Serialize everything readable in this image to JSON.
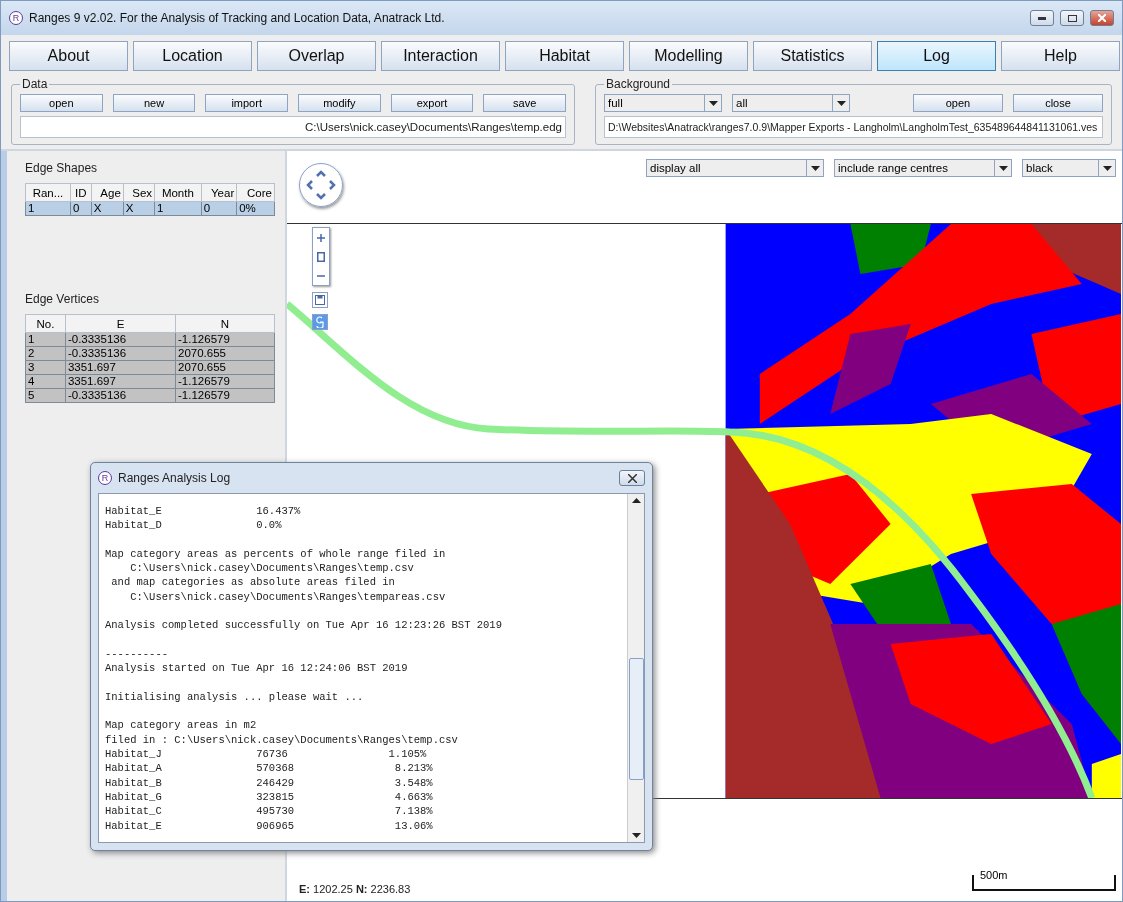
{
  "window": {
    "logo": "R",
    "title": "Ranges 9 v2.02. For the Analysis of Tracking and Location Data, Anatrack Ltd."
  },
  "menu": [
    {
      "label": "About",
      "selected": false
    },
    {
      "label": "Location",
      "selected": false
    },
    {
      "label": "Overlap",
      "selected": false
    },
    {
      "label": "Interaction",
      "selected": false
    },
    {
      "label": "Habitat",
      "selected": false
    },
    {
      "label": "Modelling",
      "selected": false
    },
    {
      "label": "Statistics",
      "selected": false
    },
    {
      "label": "Log",
      "selected": true
    },
    {
      "label": "Help",
      "selected": false
    }
  ],
  "data_panel": {
    "title": "Data",
    "buttons": [
      "open",
      "new",
      "import",
      "modify",
      "export",
      "save"
    ],
    "path": "C:\\Users\\nick.casey\\Documents\\Ranges\\temp.edg"
  },
  "background_panel": {
    "title": "Background",
    "dropdowns": [
      "full",
      "all"
    ],
    "buttons": [
      "open",
      "close"
    ],
    "path": "D:\\Websites\\Anatrack\\ranges7.0.9\\Mapper Exports - Langholm\\LangholmTest_635489644841131061.ves"
  },
  "edge_shapes": {
    "title": "Edge Shapes",
    "columns": [
      "Ran...",
      "ID",
      "Age",
      "Sex",
      "Month",
      "Year",
      "Core"
    ],
    "rows": [
      {
        "cells": [
          "1",
          "0",
          "X",
          "X",
          "1",
          "0",
          "0%"
        ],
        "selected": true
      }
    ]
  },
  "edge_vertices": {
    "title": "Edge Vertices",
    "columns": [
      "No.",
      "E",
      "N"
    ],
    "rows": [
      {
        "cells": [
          "1",
          "-0.3335136",
          "-1.126579"
        ],
        "selected": true
      },
      {
        "cells": [
          "2",
          "-0.3335136",
          "2070.655"
        ],
        "selected": true
      },
      {
        "cells": [
          "3",
          "3351.697",
          "2070.655"
        ],
        "selected": true
      },
      {
        "cells": [
          "4",
          "3351.697",
          "-1.126579"
        ],
        "selected": true
      },
      {
        "cells": [
          "5",
          "-0.3335136",
          "-1.126579"
        ],
        "selected": true
      }
    ]
  },
  "map_options": [
    "display all",
    "include range centres",
    "black"
  ],
  "status": {
    "coordinates": "**E:** 1202.25 **N:** 2236.83",
    "scale": "500m"
  },
  "log_window": {
    "logo": "R",
    "title": "Ranges Analysis Log",
    "paragraphs": [
      [
        "Habitat_E               16.437%",
        "Habitat_D               0.0%"
      ],
      [
        "Map category areas as percents of whole range filed in",
        "    C:\\Users\\nick.casey\\Documents\\Ranges\\temp.csv",
        " and map categories as absolute areas filed in",
        "    C:\\Users\\nick.casey\\Documents\\Ranges\\tempareas.csv"
      ],
      [
        "Analysis completed successfully on Tue Apr 16 12:23:26 BST 2019"
      ],
      [
        "----------",
        "Analysis started on Tue Apr 16 12:24:06 BST 2019"
      ],
      [
        "Initialising analysis ... please wait ..."
      ],
      [
        "Map category areas in m2",
        "filed in : C:\\Users\\nick.casey\\Documents\\Ranges\\temp.csv",
        "Habitat_J               76736                1.105%",
        "Habitat_A               570368                8.213%",
        "Habitat_B               246429                3.548%",
        "Habitat_G               323815                4.663%",
        "Habitat_C               495730                7.138%",
        "Habitat_E               906965                13.06%"
      ]
    ]
  }
}
